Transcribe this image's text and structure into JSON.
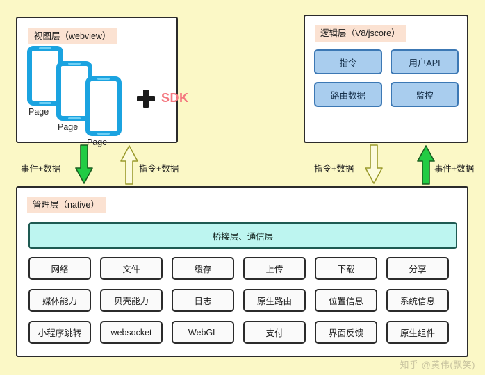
{
  "diagram": {
    "background_color": "#fbf8c6",
    "view_layer": {
      "title": "视图层（webview）",
      "pages": [
        "Page",
        "Page",
        "Page"
      ],
      "plus_icon": "plus-icon",
      "sdk_label": "SDK",
      "sdk_color": "#f4777f",
      "phone_color": "#1ba3e0"
    },
    "logic_layer": {
      "title": "逻辑层（V8/jscore）",
      "buttons": [
        {
          "label": "指令"
        },
        {
          "label": "用户API"
        },
        {
          "label": "路由数据"
        },
        {
          "label": "监控"
        }
      ],
      "button_fill": "#a9cdee",
      "button_border": "#3c78b4"
    },
    "management_layer": {
      "title": "管理层（native）",
      "bridge_bar": {
        "label": "桥接层、通信层",
        "fill": "#bdf5f0",
        "border": "#1e5a52"
      },
      "modules": [
        "网络",
        "文件",
        "缓存",
        "上传",
        "下载",
        "分享",
        "媒体能力",
        "贝壳能力",
        "日志",
        "原生路由",
        "位置信息",
        "系统信息",
        "小程序跳转",
        "websocket",
        "WebGL",
        "支付",
        "界面反馈",
        "原生组件"
      ]
    },
    "arrows": [
      {
        "id": "left-down",
        "label": "事件+数据",
        "direction": "down",
        "color": "green",
        "fill": "#22cc44"
      },
      {
        "id": "left-up",
        "label": "指令+数据",
        "direction": "up",
        "color": "yellow",
        "fill": "#fcfbdd"
      },
      {
        "id": "right-down",
        "label": "指令+数据",
        "direction": "down",
        "color": "yellow",
        "fill": "#fcfbdd"
      },
      {
        "id": "right-up",
        "label": "事件+数据",
        "direction": "up",
        "color": "green",
        "fill": "#22cc44"
      }
    ],
    "watermark": "知乎 @黄伟(飘笑)"
  }
}
